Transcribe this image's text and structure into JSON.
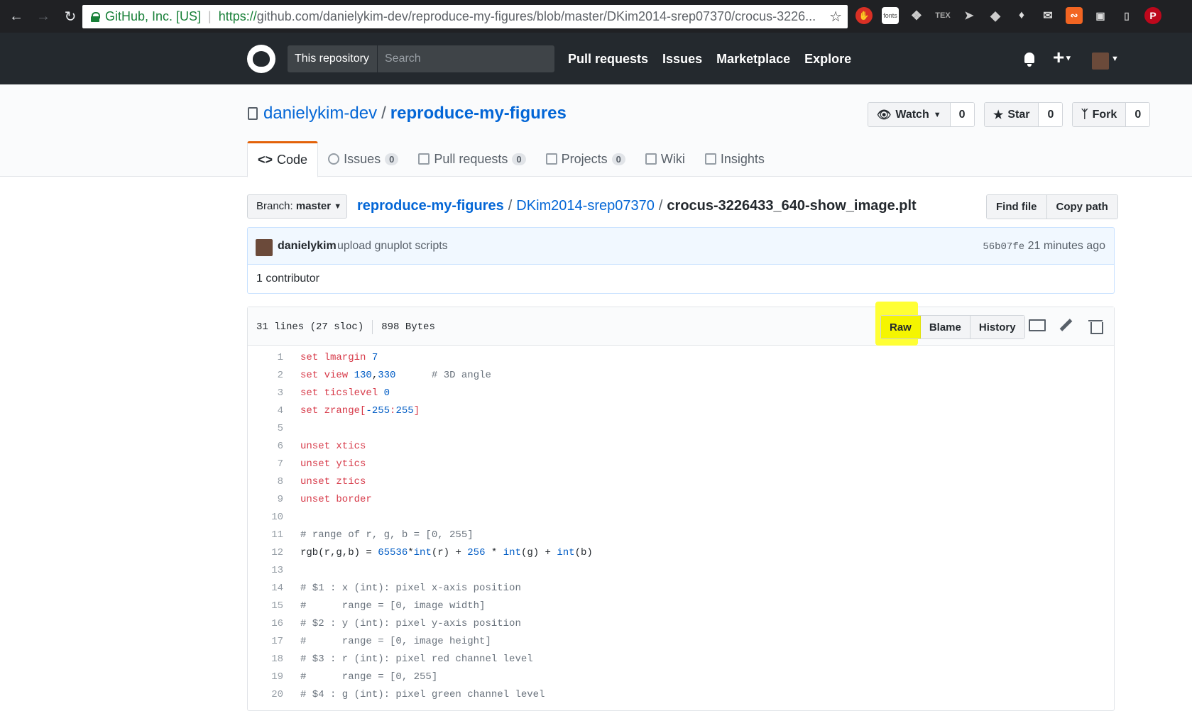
{
  "browser": {
    "cert": "GitHub, Inc. [US]",
    "url_https": "https://",
    "url_rest": "github.com/danielykim-dev/reproduce-my-figures/blob/master/DKim2014-srep07370/crocus-3226...",
    "ext_icons": [
      "stop-icon",
      "fonts-icon",
      "dropbox-icon",
      "tex-icon",
      "cursor-icon",
      "diamond-icon",
      "evernote-icon",
      "inbox-icon",
      "rss-icon",
      "screen-icon",
      "pdf-icon",
      "pinterest-icon"
    ],
    "fonts_label": "fonts",
    "tex_label": "TEX"
  },
  "header": {
    "scope_label": "This repository",
    "search_placeholder": "Search",
    "nav": [
      "Pull requests",
      "Issues",
      "Marketplace",
      "Explore"
    ]
  },
  "repo": {
    "owner": "danielykim-dev",
    "name": "reproduce-my-figures",
    "watch_label": "Watch",
    "watch_count": "0",
    "star_label": "Star",
    "star_count": "0",
    "fork_label": "Fork",
    "fork_count": "0"
  },
  "tabs": [
    {
      "label": "Code",
      "count": null,
      "icon": "code-icon"
    },
    {
      "label": "Issues",
      "count": "0",
      "icon": "issue-icon"
    },
    {
      "label": "Pull requests",
      "count": "0",
      "icon": "pull-request-icon"
    },
    {
      "label": "Projects",
      "count": "0",
      "icon": "project-icon"
    },
    {
      "label": "Wiki",
      "count": null,
      "icon": "book-icon"
    },
    {
      "label": "Insights",
      "count": null,
      "icon": "graph-icon"
    }
  ],
  "filenav": {
    "branch_prefix": "Branch:",
    "branch": "master",
    "crumb_repo": "reproduce-my-figures",
    "crumb_dir": "DKim2014-srep07370",
    "crumb_file": "crocus-3226433_640-show_image.plt",
    "find_file": "Find file",
    "copy_path": "Copy path"
  },
  "commit": {
    "author": "danielykim",
    "message": "upload gnuplot scripts",
    "sha": "56b07fe",
    "time": "21 minutes ago",
    "contributors": "1 contributor"
  },
  "file": {
    "lines_info": "31 lines (27 sloc)",
    "size": "898 Bytes",
    "raw": "Raw",
    "blame": "Blame",
    "history": "History"
  },
  "code": [
    [
      [
        "k",
        "set lmargin "
      ],
      [
        "n",
        "7"
      ]
    ],
    [
      [
        "k",
        "set view "
      ],
      [
        "n",
        "130"
      ],
      [
        "p",
        ","
      ],
      [
        "n",
        "330"
      ],
      [
        "p",
        "      "
      ],
      [
        "c",
        "# 3D angle"
      ]
    ],
    [
      [
        "k",
        "set ticslevel "
      ],
      [
        "n",
        "0"
      ]
    ],
    [
      [
        "k",
        "set zrange["
      ],
      [
        "n",
        "-255"
      ],
      [
        "k",
        ":"
      ],
      [
        "n",
        "255"
      ],
      [
        "k",
        "]"
      ]
    ],
    [],
    [
      [
        "k",
        "unset xtics"
      ]
    ],
    [
      [
        "k",
        "unset ytics"
      ]
    ],
    [
      [
        "k",
        "unset ztics"
      ]
    ],
    [
      [
        "k",
        "unset border"
      ]
    ],
    [],
    [
      [
        "c",
        "# range of r, g, b = [0, 255]"
      ]
    ],
    [
      [
        "p",
        "rgb(r,g,b) = "
      ],
      [
        "n",
        "65536"
      ],
      [
        "p",
        "*"
      ],
      [
        "n",
        "int"
      ],
      [
        "p",
        "(r) + "
      ],
      [
        "n",
        "256"
      ],
      [
        "p",
        " * "
      ],
      [
        "n",
        "int"
      ],
      [
        "p",
        "(g) + "
      ],
      [
        "n",
        "int"
      ],
      [
        "p",
        "(b)"
      ]
    ],
    [],
    [
      [
        "c",
        "# $1 : x (int): pixel x-axis position"
      ]
    ],
    [
      [
        "c",
        "#      range = [0, image width]"
      ]
    ],
    [
      [
        "c",
        "# $2 : y (int): pixel y-axis position"
      ]
    ],
    [
      [
        "c",
        "#      range = [0, image height]"
      ]
    ],
    [
      [
        "c",
        "# $3 : r (int): pixel red channel level"
      ]
    ],
    [
      [
        "c",
        "#      range = [0, 255]"
      ]
    ],
    [
      [
        "c",
        "# $4 : g (int): pixel green channel level"
      ]
    ]
  ]
}
